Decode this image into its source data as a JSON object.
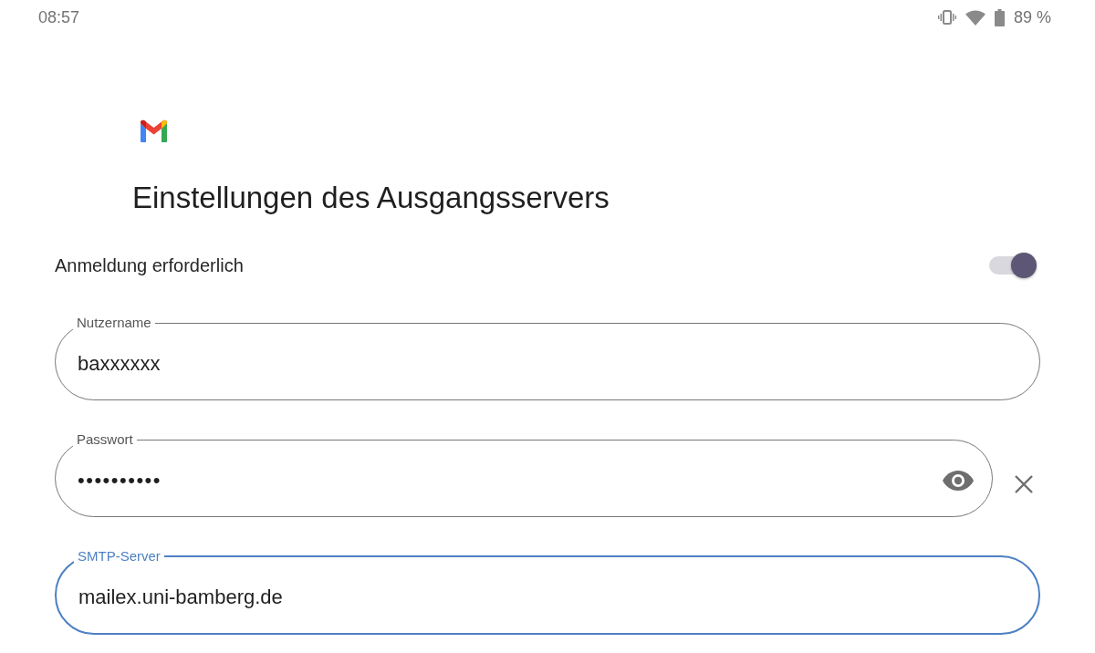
{
  "status_bar": {
    "time": "08:57",
    "battery": "89 %"
  },
  "title": "Einstellungen des Ausgangsservers",
  "login_required": {
    "label": "Anmeldung erforderlich",
    "on": true
  },
  "fields": [
    {
      "kind": "text",
      "label": "Nutzername",
      "value": "baxxxxxx",
      "focused": false
    },
    {
      "kind": "password",
      "label": "Passwort",
      "value": "••••••••••",
      "focused": false
    },
    {
      "kind": "text",
      "label": "SMTP-Server",
      "value": "mailex.uni-bamberg.de",
      "focused": true
    }
  ]
}
